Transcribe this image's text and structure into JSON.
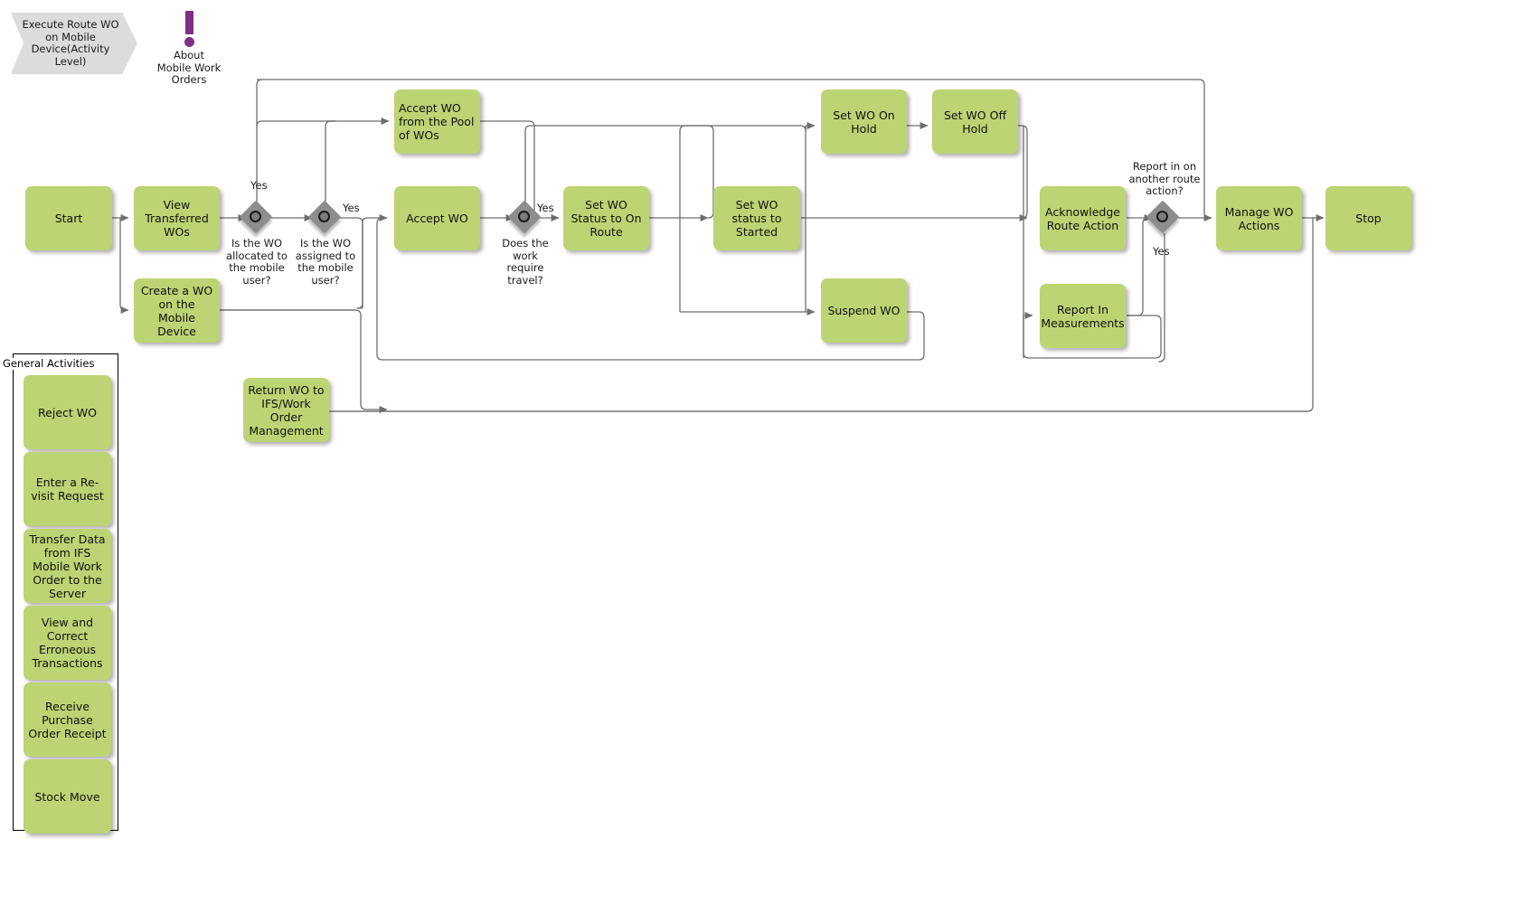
{
  "title_banner": {
    "label": "Execute Route WO on Mobile Device(Activity Level)"
  },
  "info_marker": {
    "icon": "exclamation-icon",
    "label": "About\nMobile Work\nOrders"
  },
  "colors": {
    "activity_fill": "#bcd473",
    "gateway_fill": "#8d8d8d",
    "banner_fill": "#dcdcdc",
    "info_accent": "#7d2f86",
    "connector": "#6e6e6e",
    "text": "#1a1a1a"
  },
  "nodes": [
    {
      "id": "start",
      "label": "Start"
    },
    {
      "id": "view_transferred",
      "label": "View Transferred WOs"
    },
    {
      "id": "create_wo",
      "label": "Create a WO on the Mobile Device"
    },
    {
      "id": "accept_pool",
      "label": "Accept WO from the Pool of WOs"
    },
    {
      "id": "accept_wo",
      "label": "Accept WO"
    },
    {
      "id": "set_on_route",
      "label": "Set WO Status to On Route"
    },
    {
      "id": "set_started",
      "label": "Set WO status to Started"
    },
    {
      "id": "set_on_hold",
      "label": "Set WO On Hold"
    },
    {
      "id": "set_off_hold",
      "label": "Set WO Off Hold"
    },
    {
      "id": "suspend_wo",
      "label": "Suspend WO"
    },
    {
      "id": "ack_route",
      "label": "Acknowledge Route Action"
    },
    {
      "id": "report_in",
      "label": "Report In Measurements"
    },
    {
      "id": "manage_wo",
      "label": "Manage WO Actions"
    },
    {
      "id": "stop",
      "label": "Stop"
    },
    {
      "id": "return_wo",
      "label": "Return WO to IFS/Work Order Management"
    }
  ],
  "gateways": [
    {
      "id": "gw_allocated",
      "question": "Is the WO allocated to the mobile user?",
      "yes_label": "Yes"
    },
    {
      "id": "gw_assigned",
      "question": "Is the WO assigned to the mobile user?",
      "yes_label": "Yes"
    },
    {
      "id": "gw_travel",
      "question": "Does the work require travel?",
      "yes_label": "Yes"
    },
    {
      "id": "gw_report",
      "question": "Report in on another route action?",
      "yes_label": "Yes"
    }
  ],
  "group": {
    "label": "General Activities",
    "items": [
      {
        "id": "reject_wo",
        "label": "Reject WO"
      },
      {
        "id": "revisit",
        "label": "Enter a Re-visit Request"
      },
      {
        "id": "transfer",
        "label": "Transfer Data from IFS Mobile Work Order to the Server"
      },
      {
        "id": "view_correct",
        "label": "View and Correct Erroneous Transactions"
      },
      {
        "id": "receive_po",
        "label": "Receive Purchase Order Receipt"
      },
      {
        "id": "stock_move",
        "label": "Stock Move"
      }
    ]
  }
}
